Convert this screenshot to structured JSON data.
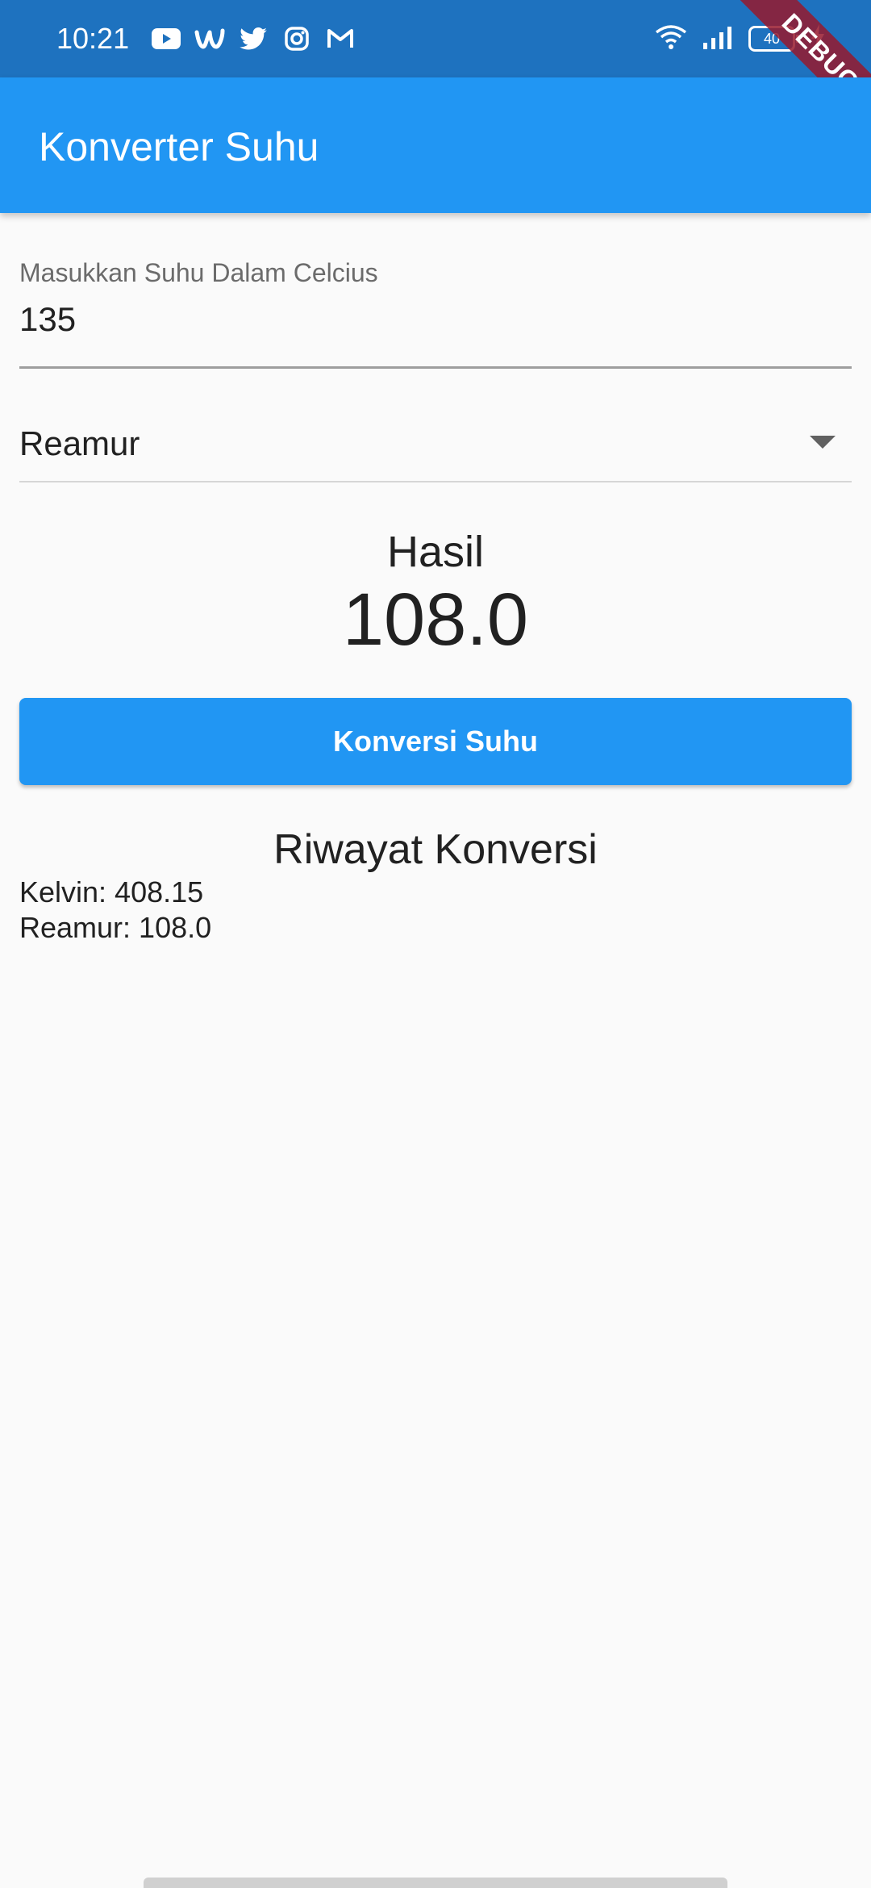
{
  "status_bar": {
    "time": "10:21",
    "battery": "40",
    "left_icons": [
      "youtube-icon",
      "wattpad-icon",
      "twitter-icon",
      "instagram-icon",
      "gmail-icon"
    ],
    "right_icons": [
      "wifi-icon",
      "signal-icon",
      "battery-icon",
      "charging-icon"
    ]
  },
  "debug_banner": "DEBUG",
  "app_bar": {
    "title": "Konverter Suhu"
  },
  "input": {
    "label": "Masukkan Suhu Dalam Celcius",
    "value": "135"
  },
  "dropdown": {
    "selected": "Reamur"
  },
  "result": {
    "label": "Hasil",
    "value": "108.0"
  },
  "convert_button": {
    "label": "Konversi Suhu"
  },
  "history": {
    "title": "Riwayat Konversi",
    "items": [
      "Kelvin: 408.15",
      "Reamur: 108.0"
    ]
  },
  "colors": {
    "primary": "#2196f3",
    "status_bar": "#1e72bf",
    "background": "#fafafa",
    "debug_banner": "#96192d"
  }
}
